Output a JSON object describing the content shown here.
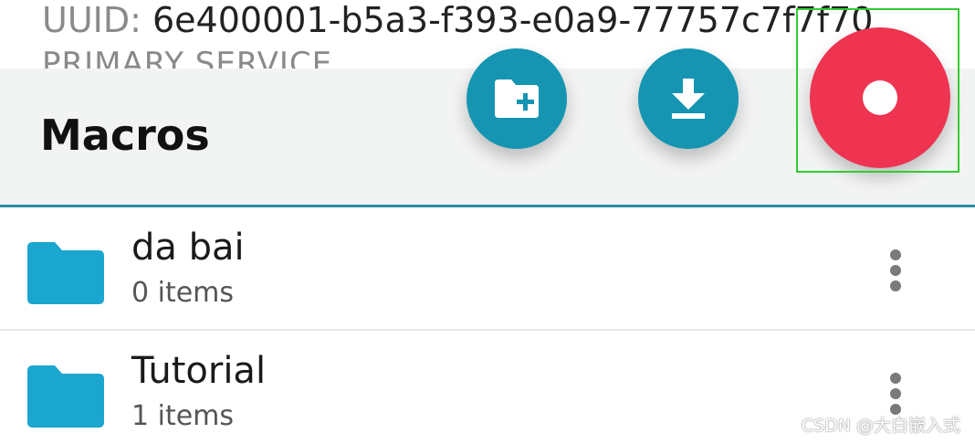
{
  "service_info": {
    "uuid_label": "UUID:",
    "uuid_value": "6e400001-b5a3-f393-e0a9-77757c7f7f70",
    "type_text": "PRIMARY SERVICE"
  },
  "macros": {
    "title": "Macros",
    "items": [
      {
        "name": "da bai",
        "count": "0 items"
      },
      {
        "name": "Tutorial",
        "count": "1 items"
      }
    ]
  },
  "toolbar": {
    "new_folder_icon": "create-new-folder-icon",
    "import_icon": "download-icon",
    "record_icon": "record-icon"
  },
  "colors": {
    "accent": "#1595b2",
    "record": "#ee3450",
    "folder": "#1ba6cf",
    "divider": "#2a8fa3"
  },
  "watermark": "CSDN @大白嵌入式"
}
